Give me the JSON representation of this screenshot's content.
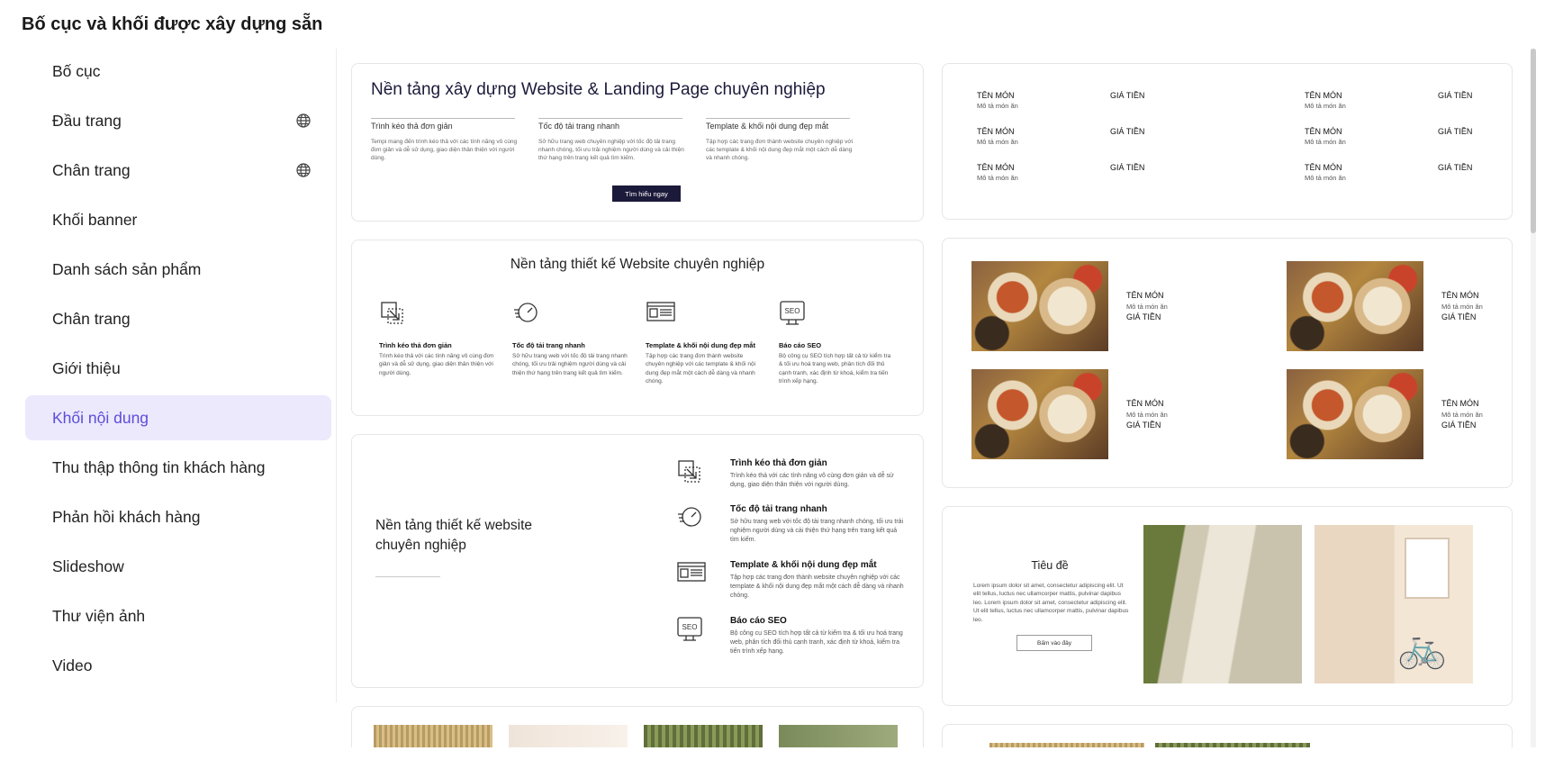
{
  "page_title": "Bố cục và khối được xây dựng sẵn",
  "sidebar": {
    "items": [
      {
        "label": "Bố cục",
        "icon": "",
        "active": false
      },
      {
        "label": "Đầu trang",
        "icon": "globe-icon",
        "active": false
      },
      {
        "label": "Chân trang",
        "icon": "globe-icon",
        "active": false
      },
      {
        "label": "Khối banner",
        "icon": "",
        "active": false
      },
      {
        "label": "Danh sách sản phẩm",
        "icon": "",
        "active": false
      },
      {
        "label": "Chân trang",
        "icon": "",
        "active": false
      },
      {
        "label": "Giới thiệu",
        "icon": "",
        "active": false
      },
      {
        "label": "Khối nội dung",
        "icon": "",
        "active": true
      },
      {
        "label": "Thu thập thông tin khách hàng",
        "icon": "",
        "active": false
      },
      {
        "label": "Phản hồi khách hàng",
        "icon": "",
        "active": false
      },
      {
        "label": "Slideshow",
        "icon": "",
        "active": false
      },
      {
        "label": "Thư viện ảnh",
        "icon": "",
        "active": false
      },
      {
        "label": "Video",
        "icon": "",
        "active": false
      }
    ]
  },
  "colors": {
    "active_bg": "#ece9fc",
    "active_text": "#5b4dd9",
    "button_dark": "#1c1a3a"
  },
  "card1": {
    "heading": "Nền tảng xây dựng Website & Landing Page chuyên nghiệp",
    "cols": [
      {
        "title": "Trình kéo thả đơn giản",
        "text": "Tempi mang đến trình kéo thả với các tính năng vô cùng đơn giản và dễ sử dụng, giao diện thân thiện với người dùng."
      },
      {
        "title": "Tốc độ tải trang nhanh",
        "text": "Sở hữu trang web chuyên nghiệp với tốc độ tải trang nhanh chóng, tối ưu trải nghiệm người dùng và cải thiện thứ hạng trên trang kết quả tìm kiếm."
      },
      {
        "title": "Template & khối nội dung đẹp mắt",
        "text": "Tập hợp các trang đơn thành website chuyên nghiệp với các template & khối nội dung đẹp mắt một cách dễ dàng và nhanh chóng."
      }
    ],
    "button": "Tìm hiểu ngay"
  },
  "card2": {
    "heading": "Nền tảng thiết kế Website chuyên nghiệp",
    "features": [
      {
        "icon": "drag-drop-icon",
        "title": "Trình kéo thả đơn giản",
        "text": "Trình kéo thả với các tính năng vô cùng đơn giản và dễ sử dụng, giao diện thân thiện với người dùng."
      },
      {
        "icon": "speedometer-icon",
        "title": "Tốc độ tải trang nhanh",
        "text": "Sở hữu trang web với tốc độ tải trang nhanh chóng, tối ưu trải nghiệm người dùng và cải thiện thứ hạng trên trang kết quả tìm kiếm."
      },
      {
        "icon": "template-icon",
        "title": "Template & khối nội dung đẹp mắt",
        "text": "Tập hợp các trang đơn thành website chuyên nghiệp với các template & khối nội dung đẹp mắt một cách dễ dàng và nhanh chóng."
      },
      {
        "icon": "seo-icon",
        "title": "Báo cáo SEO",
        "text": "Bộ công cụ SEO tích hợp tất cả từ kiểm tra & tối ưu hoá trang web, phân tích đối thủ cạnh tranh, xác định từ khoá, kiểm tra tiến trình xếp hạng."
      }
    ]
  },
  "card3": {
    "heading": "Nền tảng thiết kế website chuyên nghiệp",
    "features": [
      {
        "icon": "drag-drop-icon",
        "title": "Trình kéo thả đơn giản",
        "text": "Trình kéo thả với các tính năng vô cùng đơn giản và dễ sử dụng, giao diện thân thiện với người dùng."
      },
      {
        "icon": "speedometer-icon",
        "title": "Tốc độ tải trang nhanh",
        "text": "Sở hữu trang web với tốc độ tải trang nhanh chóng, tối ưu trải nghiệm người dùng và cải thiện thứ hạng trên trang kết quả tìm kiếm."
      },
      {
        "icon": "template-icon",
        "title": "Template & khối nội dung đẹp mắt",
        "text": "Tập hợp các trang đơn thành website chuyên nghiệp với các template & khối nội dung đẹp mắt một cách dễ dàng và nhanh chóng."
      },
      {
        "icon": "seo-icon",
        "title": "Báo cáo SEO",
        "text": "Bộ công cụ SEO tích hợp tất cả từ kiểm tra & tối ưu hoá trang web, phân tích đối thủ cạnh tranh, xác định từ khoá, kiểm tra tiến trình xếp hạng."
      }
    ]
  },
  "menu_card": {
    "name": "TÊN MÓN",
    "desc": "Mô tả món ăn",
    "price": "GIÁ TIỀN"
  },
  "food_card": {
    "name": "TÊN MÓN",
    "desc": "Mô tả món ăn",
    "price": "GIÁ TIỀN"
  },
  "blog_card": {
    "heading": "Tiêu đề",
    "text": "Lorem ipsum dolor sit amet, consectetur adipiscing elit. Ut elit tellus, luctus nec ullamcorper mattis, pulvinar dapibus leo. Lorem ipsum dolor sit amet, consectetur adipiscing elit. Ut elit tellus, luctus nec ullamcorper mattis, pulvinar dapibus leo.",
    "button": "Bấm vào đây"
  }
}
